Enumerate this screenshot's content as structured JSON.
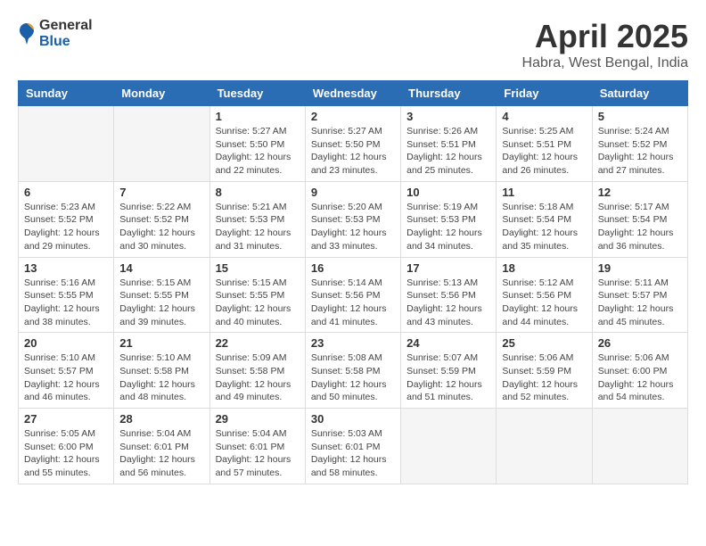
{
  "logo": {
    "general": "General",
    "blue": "Blue"
  },
  "title": {
    "month": "April 2025",
    "location": "Habra, West Bengal, India"
  },
  "weekdays": [
    "Sunday",
    "Monday",
    "Tuesday",
    "Wednesday",
    "Thursday",
    "Friday",
    "Saturday"
  ],
  "weeks": [
    [
      {
        "day": "",
        "empty": true
      },
      {
        "day": "",
        "empty": true
      },
      {
        "day": "1",
        "sunrise": "5:27 AM",
        "sunset": "5:50 PM",
        "daylight": "12 hours and 22 minutes."
      },
      {
        "day": "2",
        "sunrise": "5:27 AM",
        "sunset": "5:50 PM",
        "daylight": "12 hours and 23 minutes."
      },
      {
        "day": "3",
        "sunrise": "5:26 AM",
        "sunset": "5:51 PM",
        "daylight": "12 hours and 25 minutes."
      },
      {
        "day": "4",
        "sunrise": "5:25 AM",
        "sunset": "5:51 PM",
        "daylight": "12 hours and 26 minutes."
      },
      {
        "day": "5",
        "sunrise": "5:24 AM",
        "sunset": "5:52 PM",
        "daylight": "12 hours and 27 minutes."
      }
    ],
    [
      {
        "day": "6",
        "sunrise": "5:23 AM",
        "sunset": "5:52 PM",
        "daylight": "12 hours and 29 minutes."
      },
      {
        "day": "7",
        "sunrise": "5:22 AM",
        "sunset": "5:52 PM",
        "daylight": "12 hours and 30 minutes."
      },
      {
        "day": "8",
        "sunrise": "5:21 AM",
        "sunset": "5:53 PM",
        "daylight": "12 hours and 31 minutes."
      },
      {
        "day": "9",
        "sunrise": "5:20 AM",
        "sunset": "5:53 PM",
        "daylight": "12 hours and 33 minutes."
      },
      {
        "day": "10",
        "sunrise": "5:19 AM",
        "sunset": "5:53 PM",
        "daylight": "12 hours and 34 minutes."
      },
      {
        "day": "11",
        "sunrise": "5:18 AM",
        "sunset": "5:54 PM",
        "daylight": "12 hours and 35 minutes."
      },
      {
        "day": "12",
        "sunrise": "5:17 AM",
        "sunset": "5:54 PM",
        "daylight": "12 hours and 36 minutes."
      }
    ],
    [
      {
        "day": "13",
        "sunrise": "5:16 AM",
        "sunset": "5:55 PM",
        "daylight": "12 hours and 38 minutes."
      },
      {
        "day": "14",
        "sunrise": "5:15 AM",
        "sunset": "5:55 PM",
        "daylight": "12 hours and 39 minutes."
      },
      {
        "day": "15",
        "sunrise": "5:15 AM",
        "sunset": "5:55 PM",
        "daylight": "12 hours and 40 minutes."
      },
      {
        "day": "16",
        "sunrise": "5:14 AM",
        "sunset": "5:56 PM",
        "daylight": "12 hours and 41 minutes."
      },
      {
        "day": "17",
        "sunrise": "5:13 AM",
        "sunset": "5:56 PM",
        "daylight": "12 hours and 43 minutes."
      },
      {
        "day": "18",
        "sunrise": "5:12 AM",
        "sunset": "5:56 PM",
        "daylight": "12 hours and 44 minutes."
      },
      {
        "day": "19",
        "sunrise": "5:11 AM",
        "sunset": "5:57 PM",
        "daylight": "12 hours and 45 minutes."
      }
    ],
    [
      {
        "day": "20",
        "sunrise": "5:10 AM",
        "sunset": "5:57 PM",
        "daylight": "12 hours and 46 minutes."
      },
      {
        "day": "21",
        "sunrise": "5:10 AM",
        "sunset": "5:58 PM",
        "daylight": "12 hours and 48 minutes."
      },
      {
        "day": "22",
        "sunrise": "5:09 AM",
        "sunset": "5:58 PM",
        "daylight": "12 hours and 49 minutes."
      },
      {
        "day": "23",
        "sunrise": "5:08 AM",
        "sunset": "5:58 PM",
        "daylight": "12 hours and 50 minutes."
      },
      {
        "day": "24",
        "sunrise": "5:07 AM",
        "sunset": "5:59 PM",
        "daylight": "12 hours and 51 minutes."
      },
      {
        "day": "25",
        "sunrise": "5:06 AM",
        "sunset": "5:59 PM",
        "daylight": "12 hours and 52 minutes."
      },
      {
        "day": "26",
        "sunrise": "5:06 AM",
        "sunset": "6:00 PM",
        "daylight": "12 hours and 54 minutes."
      }
    ],
    [
      {
        "day": "27",
        "sunrise": "5:05 AM",
        "sunset": "6:00 PM",
        "daylight": "12 hours and 55 minutes."
      },
      {
        "day": "28",
        "sunrise": "5:04 AM",
        "sunset": "6:01 PM",
        "daylight": "12 hours and 56 minutes."
      },
      {
        "day": "29",
        "sunrise": "5:04 AM",
        "sunset": "6:01 PM",
        "daylight": "12 hours and 57 minutes."
      },
      {
        "day": "30",
        "sunrise": "5:03 AM",
        "sunset": "6:01 PM",
        "daylight": "12 hours and 58 minutes."
      },
      {
        "day": "",
        "empty": true
      },
      {
        "day": "",
        "empty": true
      },
      {
        "day": "",
        "empty": true
      }
    ]
  ],
  "labels": {
    "sunrise": "Sunrise:",
    "sunset": "Sunset:",
    "daylight": "Daylight:"
  }
}
